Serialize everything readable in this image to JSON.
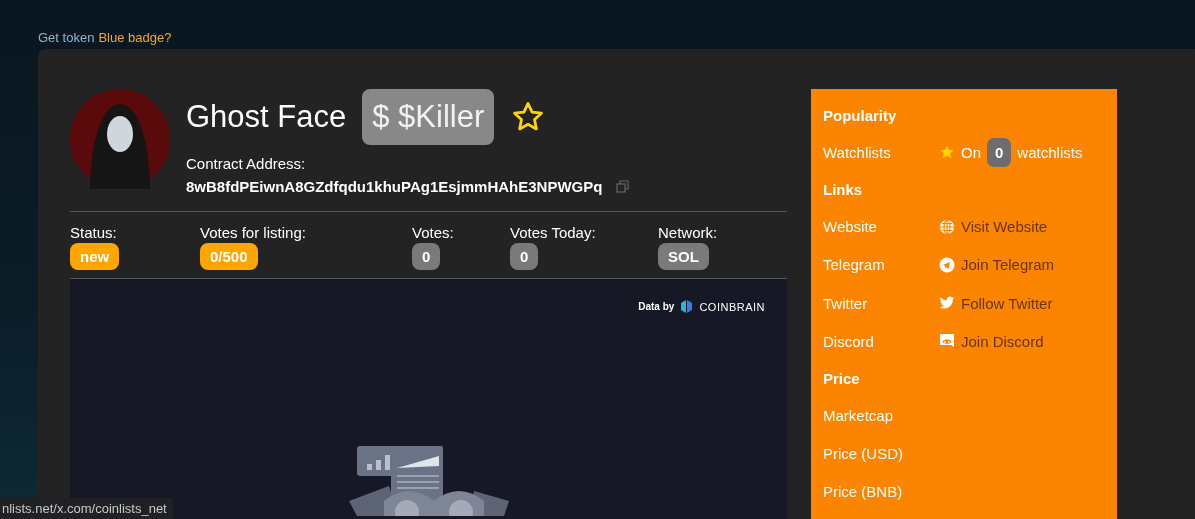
{
  "top_link": {
    "text": "Get token",
    "link": "Blue badge?"
  },
  "token": {
    "name": "Ghost Face",
    "symbol": "$ $Killer",
    "favorite": false,
    "contract_label": "Contract Address:",
    "contract": "8wB8fdPEiwnA8GZdfqdu1khuPAg1EsjmmHAhE3NPWGPq"
  },
  "stats": [
    {
      "label": "Status:",
      "value": "new",
      "kind": "accent"
    },
    {
      "label": "Votes for listing:",
      "value": "0/500",
      "kind": "accent"
    },
    {
      "label": "Votes:",
      "value": "0",
      "kind": "neutral"
    },
    {
      "label": "Votes Today:",
      "value": "0",
      "kind": "neutral"
    },
    {
      "label": "Network:",
      "value": "SOL",
      "kind": "neutral"
    }
  ],
  "chart_panel": {
    "credit": "Data by",
    "brand": "COINBRAIN"
  },
  "sidebar": {
    "sections": [
      {
        "title": "Popularity",
        "rows": [
          {
            "label": "Watchlists",
            "kind": "count",
            "prefix": "On",
            "count": "0",
            "suffix": "watchlists"
          }
        ]
      },
      {
        "title": "Links",
        "rows": [
          {
            "label": "Website",
            "kind": "website",
            "link": "Visit Website"
          },
          {
            "label": "Telegram",
            "kind": "telegram",
            "link": "Join Telegram"
          },
          {
            "label": "Twitter",
            "kind": "twitter",
            "link": "Follow Twitter"
          },
          {
            "label": "Discord",
            "kind": "discord",
            "link": "Join Discord"
          }
        ]
      },
      {
        "title": "Price",
        "rows": [
          {
            "label": "Marketcap",
            "kind": "plain"
          },
          {
            "label": "Price (USD)",
            "kind": "plain"
          },
          {
            "label": "Price (BNB)",
            "kind": "plain"
          }
        ]
      }
    ]
  },
  "status_bar": {
    "url": "nlists.net/x.com/coinlists_net"
  }
}
